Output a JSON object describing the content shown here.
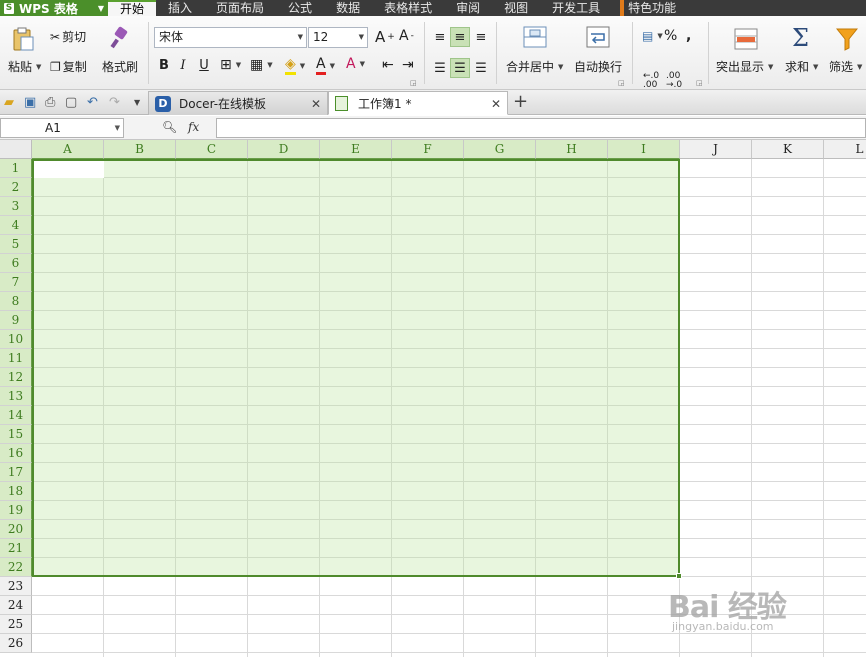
{
  "menubar": {
    "app_name": "WPS 表格",
    "tabs": [
      "开始",
      "插入",
      "页面布局",
      "公式",
      "数据",
      "表格样式",
      "审阅",
      "视图",
      "开发工具",
      "特色功能"
    ],
    "active_tab": "开始"
  },
  "ribbon": {
    "paste": "粘贴",
    "cut": "剪切",
    "copy": "复制",
    "format_painter": "格式刷",
    "font_name": "宋体",
    "font_size": "12",
    "bold": "B",
    "italic": "I",
    "underline": "U",
    "merge_center": "合并居中",
    "wrap_text": "自动换行",
    "percent": "%",
    "comma": ",",
    "highlight": "突出显示",
    "sum": "求和",
    "filter": "筛选"
  },
  "doc_tabs": [
    {
      "label": "Docer-在线模板"
    },
    {
      "label": "工作簿1 *"
    }
  ],
  "formula_bar": {
    "cell_ref": "A1",
    "fx_label": "fx",
    "value": ""
  },
  "sheet": {
    "columns": [
      "A",
      "B",
      "C",
      "D",
      "E",
      "F",
      "G",
      "H",
      "I",
      "J",
      "K",
      "L"
    ],
    "rows": [
      "1",
      "2",
      "3",
      "4",
      "5",
      "6",
      "7",
      "8",
      "9",
      "10",
      "11",
      "12",
      "13",
      "14",
      "15",
      "16",
      "17",
      "18",
      "19",
      "20",
      "21",
      "22",
      "23",
      "24",
      "25",
      "26"
    ],
    "selected_range": "A1:I22",
    "selection_color": "#e2f5d4",
    "selection_border_color": "#4f8a2c"
  },
  "watermark": {
    "brand": "Bai 经验",
    "url": "jingyan.baidu.com"
  },
  "colors": {
    "accent": "#5aa12f",
    "menubar_bg": "#3a3a3a"
  }
}
